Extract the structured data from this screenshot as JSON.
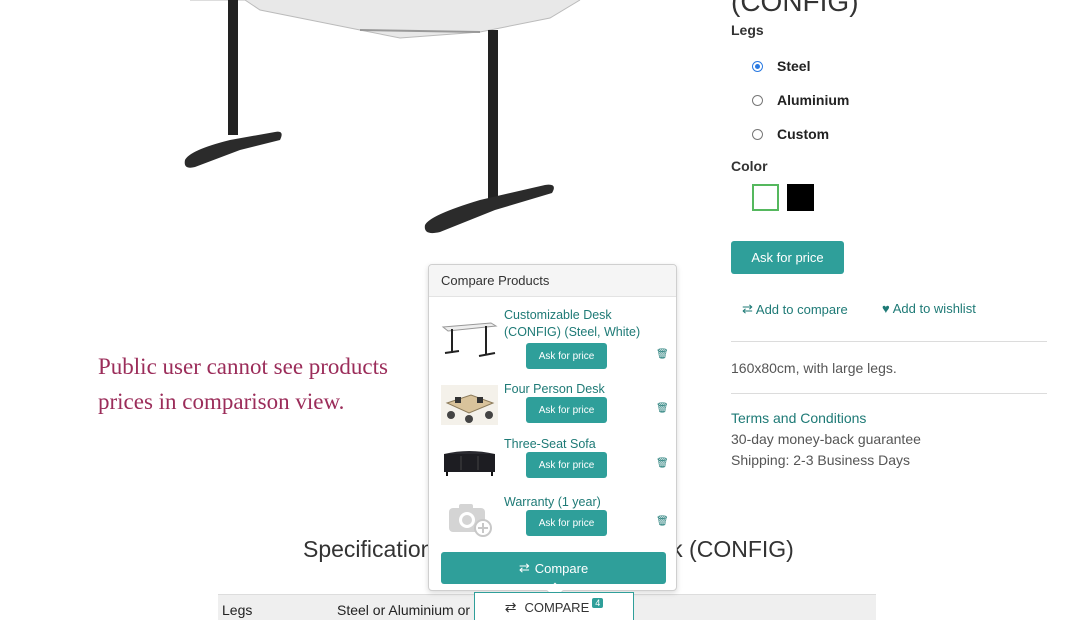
{
  "product": {
    "title_fragment": "(CONFIG)",
    "legs_label": "Legs",
    "legs_options": [
      "Steel",
      "Aluminium",
      "Custom"
    ],
    "legs_selected": "Steel",
    "color_label": "Color",
    "colors": [
      {
        "name": "White",
        "hex": "#ffffff",
        "selected": true
      },
      {
        "name": "Black",
        "hex": "#000000",
        "selected": false
      }
    ],
    "ask_price_label": "Ask for price",
    "add_to_compare_label": "Add to compare",
    "add_to_wishlist_label": "Add to wishlist",
    "description": "160x80cm, with large legs.",
    "terms_label": "Terms and Conditions",
    "guarantee": "30-day money-back guarantee",
    "shipping": "Shipping: 2-3 Business Days"
  },
  "annotation": {
    "text_line1": "Public user cannot see products",
    "text_line2": "prices in comparison view."
  },
  "compare_popover": {
    "header": "Compare Products",
    "items": [
      {
        "name": "Customizable Desk (CONFIG) (Steel, White)",
        "button": "Ask for price",
        "thumb": "desk-thumb"
      },
      {
        "name": "Four Person Desk",
        "button": "Ask for price",
        "thumb": "office-desk-thumb"
      },
      {
        "name": "Three-Seat Sofa",
        "button": "Ask for price",
        "thumb": "sofa-thumb"
      },
      {
        "name": "Warranty (1 year)",
        "button": "Ask for price",
        "thumb": "camera-placeholder-thumb"
      }
    ],
    "compare_button": "Compare"
  },
  "specifications": {
    "heading": "Specifications for Customizable Desk (CONFIG)",
    "row_label": "Legs",
    "row_value": "Steel or Aluminium or Custom"
  },
  "compare_tab": {
    "label": "COMPARE",
    "count": "4"
  },
  "colors": {
    "accent": "#2f9f9a",
    "link": "#1e7a76",
    "annotation": "#9b2d5a"
  }
}
